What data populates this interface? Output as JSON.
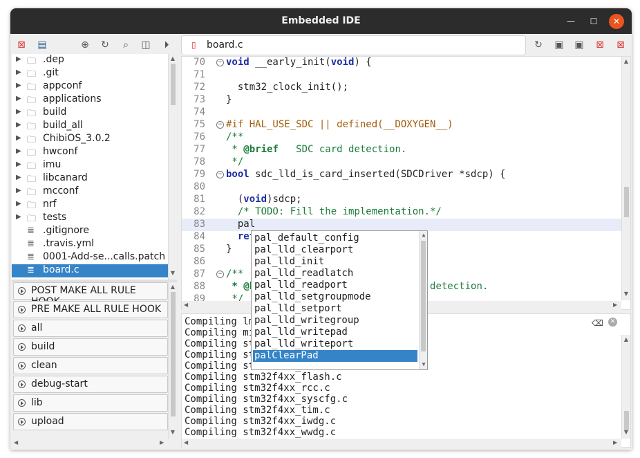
{
  "window": {
    "title": "Embedded IDE"
  },
  "toolbar": {
    "left_icons": [
      "close-project-icon",
      "project-view-icon",
      "find-icon",
      "refresh-icon",
      "search-icon",
      "export-icon",
      "run-icon"
    ],
    "right_icons": [
      "reload-icon",
      "save-icon",
      "save-all-icon",
      "close-file-icon",
      "close-all-icon"
    ]
  },
  "editor_tab": {
    "file": "board.c"
  },
  "tree": [
    {
      "label": ".dep",
      "type": "folder"
    },
    {
      "label": ".git",
      "type": "folder"
    },
    {
      "label": "appconf",
      "type": "folder"
    },
    {
      "label": "applications",
      "type": "folder"
    },
    {
      "label": "build",
      "type": "folder"
    },
    {
      "label": "build_all",
      "type": "folder"
    },
    {
      "label": "ChibiOS_3.0.2",
      "type": "folder"
    },
    {
      "label": "hwconf",
      "type": "folder"
    },
    {
      "label": "imu",
      "type": "folder"
    },
    {
      "label": "libcanard",
      "type": "folder"
    },
    {
      "label": "mcconf",
      "type": "folder"
    },
    {
      "label": "nrf",
      "type": "folder"
    },
    {
      "label": "tests",
      "type": "folder"
    },
    {
      "label": ".gitignore",
      "type": "file"
    },
    {
      "label": ".travis.yml",
      "type": "file"
    },
    {
      "label": "0001-Add-se...calls.patch",
      "type": "file"
    },
    {
      "label": "board.c",
      "type": "file",
      "selected": true
    }
  ],
  "targets": [
    "POST MAKE ALL RULE HOOK",
    "PRE MAKE ALL RULE HOOK",
    "all",
    "build",
    "clean",
    "debug-start",
    "lib",
    "upload"
  ],
  "editor": {
    "lines": [
      {
        "n": "70",
        "fold": "−",
        "segments": [
          {
            "t": "void",
            "c": "kw"
          },
          {
            "t": " __early_init("
          },
          {
            "t": "void",
            "c": "kw"
          },
          {
            "t": ") {"
          }
        ]
      },
      {
        "n": "71",
        "segments": []
      },
      {
        "n": "72",
        "segments": [
          {
            "t": "  stm32_clock_init();"
          }
        ]
      },
      {
        "n": "73",
        "segments": [
          {
            "t": "}"
          }
        ]
      },
      {
        "n": "74",
        "segments": []
      },
      {
        "n": "75",
        "fold": "−",
        "segments": [
          {
            "t": "#if HAL_USE_SDC || defined(__DOXYGEN__)",
            "c": "pp"
          }
        ]
      },
      {
        "n": "76",
        "segments": [
          {
            "t": "/**",
            "c": "cm"
          }
        ]
      },
      {
        "n": "77",
        "segments": [
          {
            "t": " * ",
            "c": "cm"
          },
          {
            "t": "@brief",
            "c": "cmb"
          },
          {
            "t": "   SDC card detection.",
            "c": "cm"
          }
        ]
      },
      {
        "n": "78",
        "segments": [
          {
            "t": " */",
            "c": "cm"
          }
        ]
      },
      {
        "n": "79",
        "fold": "−",
        "segments": [
          {
            "t": "bool",
            "c": "kw"
          },
          {
            "t": " sdc_lld_is_card_inserted(SDCDriver *sdcp) {"
          }
        ]
      },
      {
        "n": "80",
        "segments": []
      },
      {
        "n": "81",
        "segments": [
          {
            "t": "  ("
          },
          {
            "t": "void",
            "c": "kw"
          },
          {
            "t": ")sdcp;"
          }
        ]
      },
      {
        "n": "82",
        "segments": [
          {
            "t": "  /* TODO: Fill the implementation.*/",
            "c": "cm"
          }
        ]
      },
      {
        "n": "83",
        "current": true,
        "segments": [
          {
            "t": "  pal"
          }
        ]
      },
      {
        "n": "84",
        "segments": [
          {
            "t": "  ret",
            "c": "kw"
          }
        ]
      },
      {
        "n": "85",
        "segments": [
          {
            "t": "}"
          }
        ]
      },
      {
        "n": "86",
        "segments": []
      },
      {
        "n": "87",
        "fold": "−",
        "segments": [
          {
            "t": "/**",
            "c": "cm"
          }
        ]
      },
      {
        "n": "88",
        "segments": [
          {
            "t": " * @b",
            "c": "cmb"
          },
          {
            "t": "                            n detection.",
            "c": "cm"
          }
        ]
      },
      {
        "n": "89",
        "segments": [
          {
            "t": " */",
            "c": "cm"
          }
        ]
      }
    ]
  },
  "autocomplete": [
    "pal_default_config",
    "pal_lld_clearport",
    "pal_lld_init",
    "pal_lld_readlatch",
    "pal_lld_readport",
    "pal_lld_setgroupmode",
    "pal_lld_setport",
    "pal_lld_writegroup",
    "pal_lld_writepad",
    "pal_lld_writeport",
    "palClearPad"
  ],
  "autocomplete_selected": 10,
  "output": [
    "Compiling lm",
    "Compiling mi",
    "Compiling st",
    "Compiling st",
    "Compiling stm32f4xx_exti.c",
    "Compiling stm32f4xx_flash.c",
    "Compiling stm32f4xx_rcc.c",
    "Compiling stm32f4xx_syscfg.c",
    "Compiling stm32f4xx_tim.c",
    "Compiling stm32f4xx_iwdg.c",
    "Compiling stm32f4xx_wwdg.c"
  ]
}
